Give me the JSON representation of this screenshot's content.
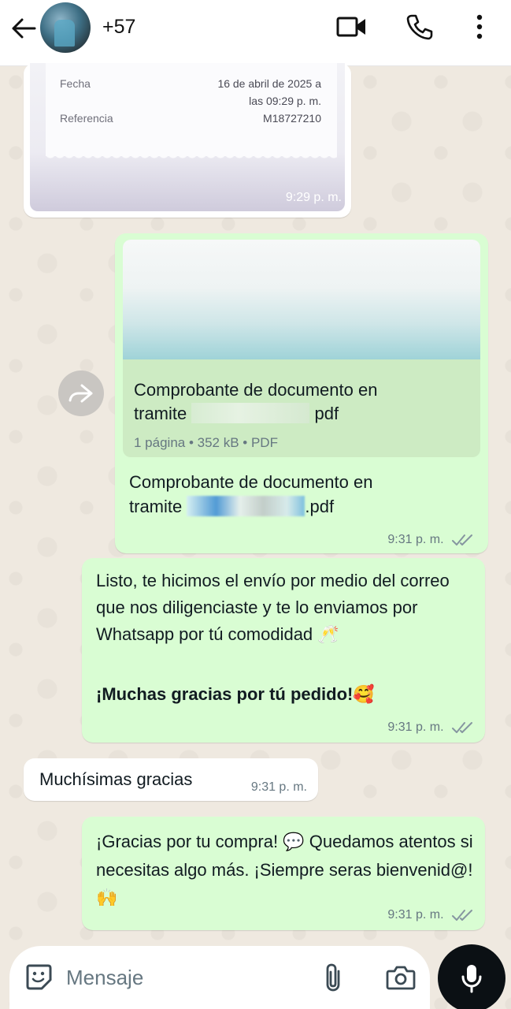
{
  "header": {
    "contact_name": "+57",
    "icons": [
      "back-arrow-icon",
      "avatar",
      "video-call-icon",
      "phone-call-icon",
      "more-vert-icon"
    ]
  },
  "receipt_image": {
    "rows": [
      {
        "label": "Fecha",
        "value": "16 de abril de 2025 a"
      },
      {
        "label": "",
        "value": "las 09:29 p. m."
      },
      {
        "label": "Referencia",
        "value": "M18727210"
      }
    ],
    "time": "9:29 p. m."
  },
  "pdf_message": {
    "file_name_start": "Comprobante de documento en",
    "file_name_line2_prefix": "tramite",
    "file_name_line2_suffix": "pdf",
    "meta": "1 página • 352 kB • PDF",
    "caption_line1": "Comprobante de documento en",
    "caption_line2_prefix": "tramite",
    "caption_line2_suffix": ".pdf",
    "time": "9:31 p. m."
  },
  "listo_message": {
    "text": "Listo, te hicimos el envío por medio del correo que nos diligenciaste y te lo enviamos por Whatsapp por tú comodidad",
    "emoji1": "🥂",
    "bold": "¡Muchas gracias por tú pedido!",
    "emoji2": "🥰",
    "time": "9:31 p. m."
  },
  "incoming_message": {
    "text": "Muchísimas gracias",
    "time": "9:31 p. m."
  },
  "compra_message": {
    "part1": "¡Gracias por tu compra!",
    "emoji1": "💬",
    "part2": "Quedamos atentos si necesitas algo más. ¡Siempre seras bienvenid@!",
    "emoji2": "🙌",
    "time": "9:31 p. m."
  },
  "composer": {
    "placeholder": "Mensaje"
  },
  "colors": {
    "outgoing_bubble": "#d9fdd3",
    "incoming_bubble": "#ffffff",
    "wallpaper": "#efe9e0",
    "read_ticks": "#8696a0"
  }
}
